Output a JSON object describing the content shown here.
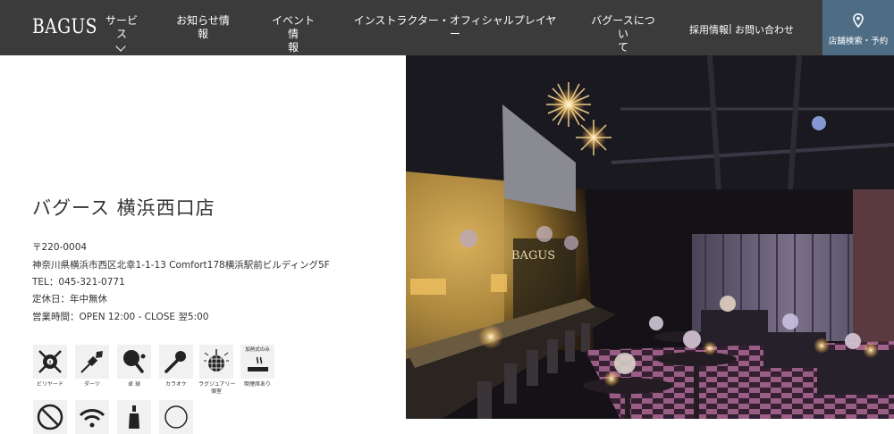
{
  "header": {
    "logo": "BAGUS",
    "nav": {
      "service_line1": "サービ",
      "service_line2": "ス",
      "news_line1": "お知らせ情",
      "news_line2": "報",
      "event_line1": "イベント情",
      "event_line2": "報",
      "instructor_line1": "インストラクター・オフィシャルプレイヤ",
      "instructor_line2": "ー",
      "about_line1": "バグースについ",
      "about_line2": "て",
      "recruit": "採用情報",
      "separator": "|",
      "contact": "お問い合わせ"
    },
    "search_button": "店舗検索・予約"
  },
  "store": {
    "name": "バグース 横浜西口店",
    "postal": "〒220-0004",
    "address": "神奈川県横浜市西区北幸1-1-13 Comfort178横浜駅前ビルディング5F",
    "tel": "TEL：045-321-0771",
    "closed": "定休日：年中無休",
    "hours": "営業時間：OPEN 12:00 - CLOSE 翌5:00"
  },
  "facilities": [
    {
      "label": "ビリヤード",
      "icon": "billiards-icon"
    },
    {
      "label": "ダーツ",
      "icon": "darts-icon"
    },
    {
      "label": "卓 球",
      "icon": "table-tennis-icon"
    },
    {
      "label": "カラオケ",
      "icon": "karaoke-icon"
    },
    {
      "label": "ラグジュアリー",
      "label2": "個室",
      "icon": "luxury-room-icon"
    },
    {
      "label": "喫煙席あり",
      "top_label": "加熱式のみ",
      "icon": "smoking-icon"
    }
  ],
  "photo": {
    "sign_text": "BAGUS"
  },
  "colors": {
    "header_bg": "#3c3b3b",
    "search_bg": "#4e6d85",
    "icon_bg": "#f1f1f1"
  }
}
